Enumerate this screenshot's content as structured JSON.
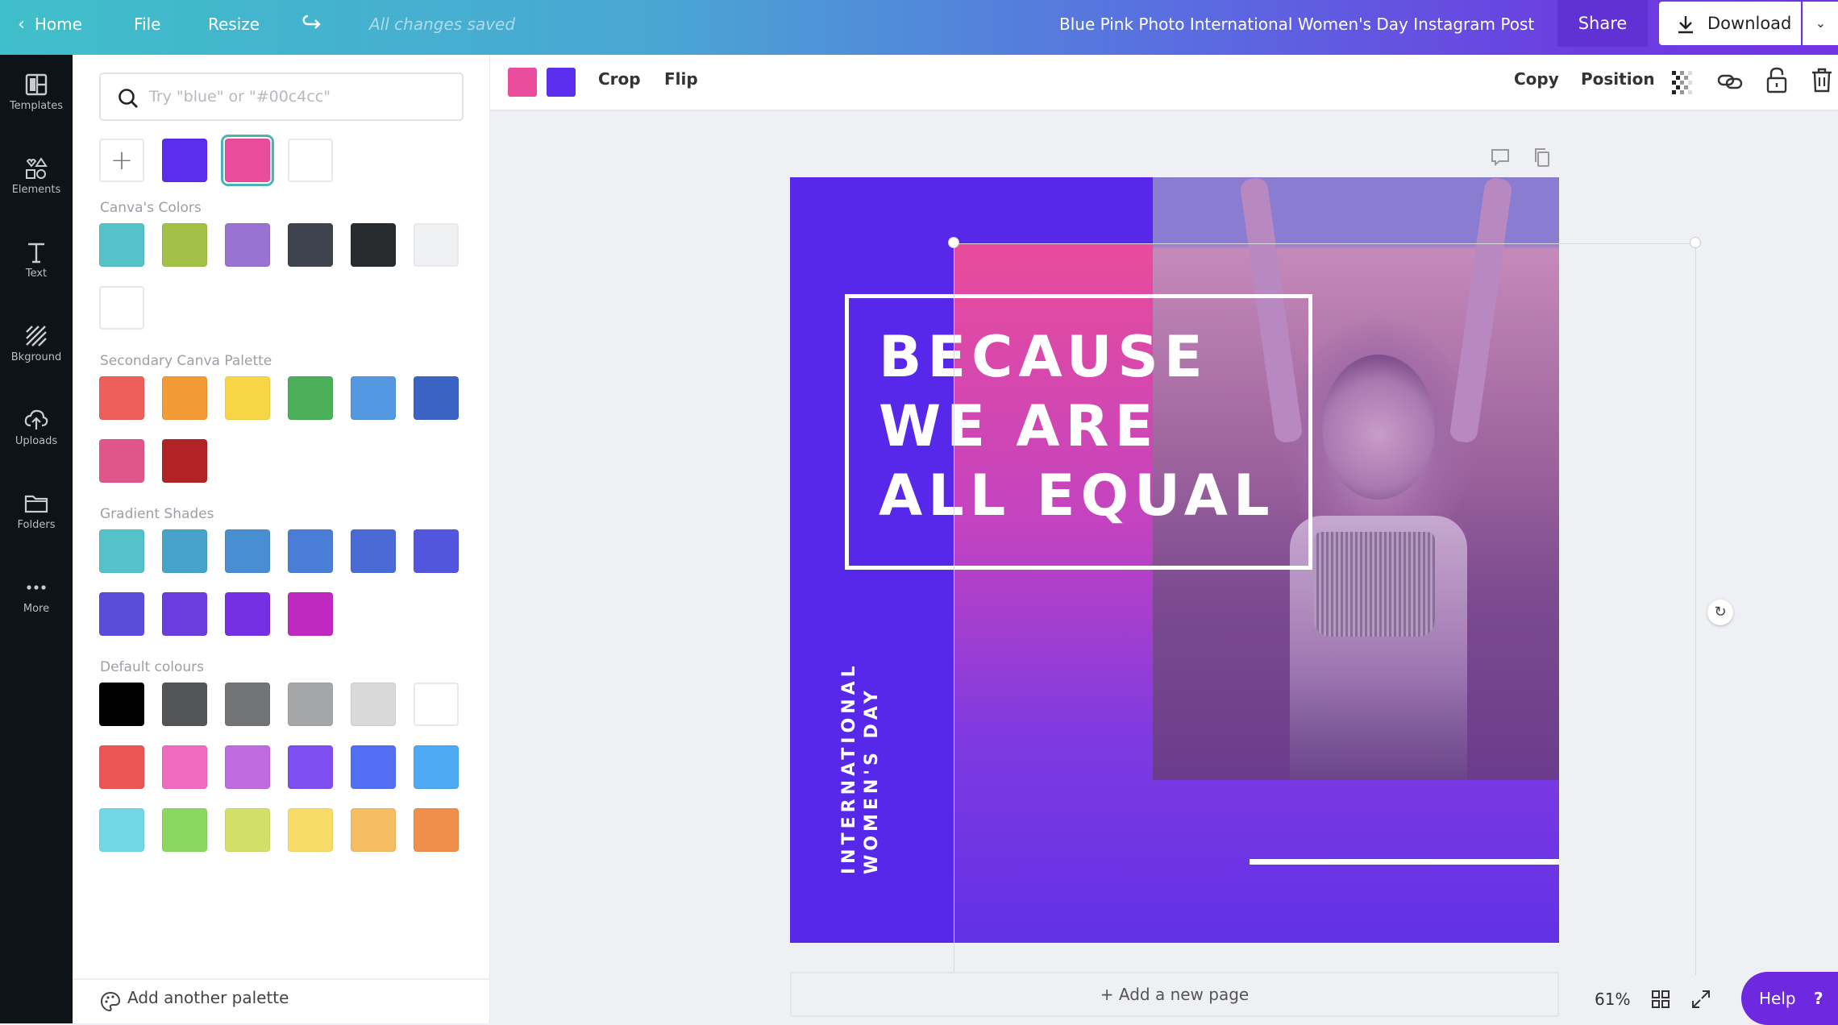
{
  "topbar": {
    "home_label": "Home",
    "file_label": "File",
    "resize_label": "Resize",
    "save_status": "All changes saved",
    "doc_title": "Blue Pink Photo International Women's Day Instagram Post",
    "share_label": "Share",
    "download_label": "Download"
  },
  "sidebar": {
    "items": [
      {
        "label": "Templates",
        "icon": "templates-icon"
      },
      {
        "label": "Elements",
        "icon": "elements-icon"
      },
      {
        "label": "Text",
        "icon": "text-icon"
      },
      {
        "label": "Bkground",
        "icon": "background-icon"
      },
      {
        "label": "Uploads",
        "icon": "uploads-icon"
      },
      {
        "label": "Folders",
        "icon": "folders-icon"
      },
      {
        "label": "More",
        "icon": "more-icon"
      }
    ]
  },
  "color_panel": {
    "search_placeholder": "Try \"blue\" or \"#00c4cc\"",
    "document_colors": [
      "#5b2ded",
      "#e84c9b",
      "#ffffff"
    ],
    "selected_color": "#e84c9b",
    "sections": [
      {
        "title": "Canva's Colors",
        "colors": [
          "#55c1c8",
          "#a2c146",
          "#9a72d1",
          "#3f434d",
          "#272b2e",
          "#eef0f2",
          "#ffffff"
        ]
      },
      {
        "title": "Secondary Canva Palette",
        "colors": [
          "#ee5f5b",
          "#f29a36",
          "#f7d645",
          "#4cb05a",
          "#5398e0",
          "#3a63c4",
          "#e0568a",
          "#b12325"
        ]
      },
      {
        "title": "Gradient Shades",
        "colors": [
          "#55c1c8",
          "#48a3cc",
          "#4a8ed2",
          "#4a7dd6",
          "#4a6bd6",
          "#5256dc",
          "#5a4ddc",
          "#6a3ddf",
          "#7630e3",
          "#c029c0"
        ]
      },
      {
        "title": "Default colours",
        "colors": [
          "#000000",
          "#545556",
          "#737475",
          "#a5a6a7",
          "#d9d9d9",
          "#ffffff",
          "#ec5654",
          "#f06bbf",
          "#c06be0",
          "#7e4ef0",
          "#526ef2",
          "#4ca9f2",
          "#72d8e6",
          "#8bd860",
          "#d2e06a",
          "#f7dd68",
          "#f4bd62",
          "#ef8f4a"
        ]
      }
    ],
    "footer_label": "Add another palette"
  },
  "toolbar": {
    "color_chips": [
      "#e84c9b",
      "#5b2ded"
    ],
    "crop_label": "Crop",
    "flip_label": "Flip",
    "copy_label": "Copy",
    "position_label": "Position"
  },
  "design": {
    "headline_lines": [
      "BECAUSE",
      "WE ARE",
      "ALL EQUAL"
    ],
    "vertical_lines": [
      "INTERNATIONAL",
      "WOMEN'S DAY"
    ],
    "colors": {
      "purple": "#5728ea",
      "pink": "#e84c9b"
    }
  },
  "canvas": {
    "add_page_label": "+ Add a new page",
    "zoom_level": "61%",
    "help_label": "Help",
    "help_icon": "?"
  }
}
